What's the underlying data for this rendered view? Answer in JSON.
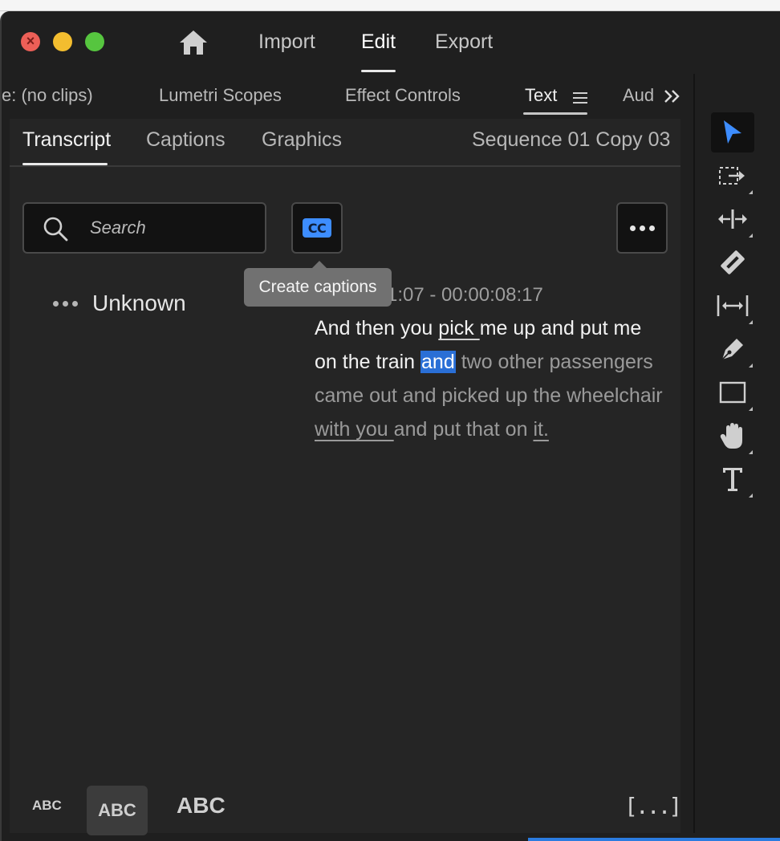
{
  "workspaces": {
    "import_label": "Import",
    "edit_label": "Edit",
    "export_label": "Export",
    "active": "Edit"
  },
  "panel_tabs": {
    "source_label": "e: (no clips)",
    "lumetri_label": "Lumetri Scopes",
    "effect_controls_label": "Effect Controls",
    "text_label": "Text",
    "audio_label": "Aud",
    "active": "Text"
  },
  "text_panel": {
    "tabs": {
      "transcript_label": "Transcript",
      "captions_label": "Captions",
      "graphics_label": "Graphics",
      "active": "Transcript"
    },
    "sequence_name": "Sequence 01 Copy 03",
    "search": {
      "placeholder": "Search",
      "value": ""
    },
    "cc_button_label": "CC",
    "tooltip": "Create captions",
    "speaker": "Unknown",
    "timecode": "1:07 - 00:00:08:17",
    "transcript_words": {
      "w1": "And then you ",
      "w2": "pick ",
      "w3": "me up and put me on the train ",
      "w4": "and",
      "w5": " two other passengers came out and picked up the wheelchair ",
      "w6": "with you ",
      "w7": "and put that on ",
      "w8": "it."
    },
    "text_size_options": {
      "small": "ABC",
      "medium": "ABC",
      "large": "ABC",
      "selected": "medium"
    },
    "bracket_button_label": "[...]"
  },
  "colors": {
    "accent_blue": "#2a6fd6",
    "cc_blue": "#3d8dff",
    "selection_tool_blue": "#3d8dff"
  },
  "icons": {
    "home": "home-icon",
    "search": "search-icon",
    "more": "more-horizontal-icon",
    "panel_menu": "hamburger-menu-icon",
    "overflow": "double-chevron-right-icon",
    "tools": [
      "selection-tool-icon",
      "track-select-forward-icon",
      "ripple-edit-icon",
      "razor-icon",
      "slip-icon",
      "pen-icon",
      "rectangle-icon",
      "hand-icon",
      "type-icon"
    ]
  }
}
